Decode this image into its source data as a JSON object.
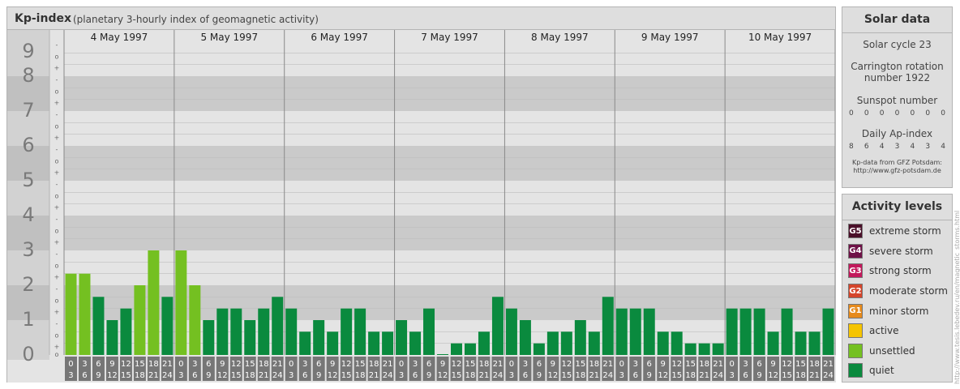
{
  "header": {
    "title": "Kp-index",
    "subtitle": "(planetary 3-hourly index of geomagnetic activity)"
  },
  "chart_data": {
    "type": "bar",
    "ylim": [
      0,
      9
    ],
    "y_tick_labels": [
      "0",
      "1",
      "2",
      "3",
      "4",
      "5",
      "6",
      "7",
      "8",
      "9"
    ],
    "minor_tick_labels": [
      "+",
      "o",
      "-"
    ],
    "days": [
      "4 May 1997",
      "5 May 1997",
      "6 May 1997",
      "7 May 1997",
      "8 May 1997",
      "9 May 1997",
      "10 May 1997"
    ],
    "hour_labels_top": [
      "0",
      "3",
      "6",
      "9",
      "12",
      "15",
      "18",
      "21"
    ],
    "hour_labels_bottom": [
      "3",
      "6",
      "9",
      "12",
      "15",
      "18",
      "21",
      "24"
    ],
    "values": [
      [
        2.333,
        2.333,
        1.667,
        1.0,
        1.333,
        2.0,
        3.0,
        1.667
      ],
      [
        3.0,
        2.0,
        1.0,
        1.333,
        1.333,
        1.0,
        1.333,
        1.667
      ],
      [
        1.333,
        0.667,
        1.0,
        0.667,
        1.333,
        1.333,
        0.667,
        0.667
      ],
      [
        1.0,
        0.667,
        1.333,
        0.0,
        0.333,
        0.333,
        0.667,
        1.667
      ],
      [
        1.333,
        1.0,
        0.333,
        0.667,
        0.667,
        1.0,
        0.667,
        1.667
      ],
      [
        1.333,
        1.333,
        1.333,
        0.667,
        0.667,
        0.333,
        0.333,
        0.333
      ],
      [
        1.333,
        1.333,
        1.333,
        0.667,
        1.333,
        0.667,
        0.667,
        1.333
      ]
    ],
    "colors": {
      "quiet": "#0a8a3e",
      "unsettled": "#74c021",
      "active": "#f5c400",
      "minor": "#e68a1c",
      "moderate": "#d5452b",
      "strong": "#c2185b",
      "severe": "#6e1247",
      "extreme": "#4a0f29"
    }
  },
  "solar": {
    "title": "Solar data",
    "cycle": "Solar cycle 23",
    "carrington": "Carrington rotation number 1922",
    "sunspot_title": "Sunspot number",
    "sunspot_values": [
      "0",
      "0",
      "0",
      "0",
      "0",
      "0",
      "0"
    ],
    "ap_title": "Daily Ap-index",
    "ap_values": [
      "8",
      "6",
      "4",
      "3",
      "4",
      "3",
      "4"
    ],
    "credit_line1": "Kp-data from GFZ Potsdam:",
    "credit_line2": "http://www.gfz-potsdam.de"
  },
  "activity": {
    "title": "Activity levels",
    "items": [
      {
        "code": "G5",
        "label": "extreme storm",
        "color": "#4a0f29"
      },
      {
        "code": "G4",
        "label": "severe storm",
        "color": "#6e1247"
      },
      {
        "code": "G3",
        "label": "strong storm",
        "color": "#c2185b"
      },
      {
        "code": "G2",
        "label": "moderate storm",
        "color": "#d5452b"
      },
      {
        "code": "G1",
        "label": "minor storm",
        "color": "#e68a1c"
      },
      {
        "code": "",
        "label": "active",
        "color": "#f5c400"
      },
      {
        "code": "",
        "label": "unsettled",
        "color": "#74c021"
      },
      {
        "code": "",
        "label": "quiet",
        "color": "#0a8a3e"
      }
    ]
  },
  "watermark": "http://www.tesis.lebedev.ru/en/magnetic_storms.html"
}
